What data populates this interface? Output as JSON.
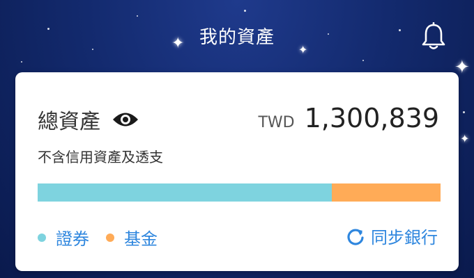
{
  "header": {
    "title": "我的資產",
    "bell_icon": "bell-icon"
  },
  "assets": {
    "total_label": "總資產",
    "visibility_icon": "eye-icon",
    "currency": "TWD",
    "amount": "1,300,839",
    "subtitle": "不含信用資產及透支"
  },
  "breakdown": {
    "segments": [
      {
        "label": "證券",
        "share": 0.73,
        "color": "#7ed3df"
      },
      {
        "label": "基金",
        "share": 0.27,
        "color": "#ffab57"
      }
    ]
  },
  "actions": {
    "sync_label": "同步銀行",
    "sync_icon": "refresh-icon"
  },
  "colors": {
    "accent": "#2e86de",
    "background": "#132a6e"
  }
}
